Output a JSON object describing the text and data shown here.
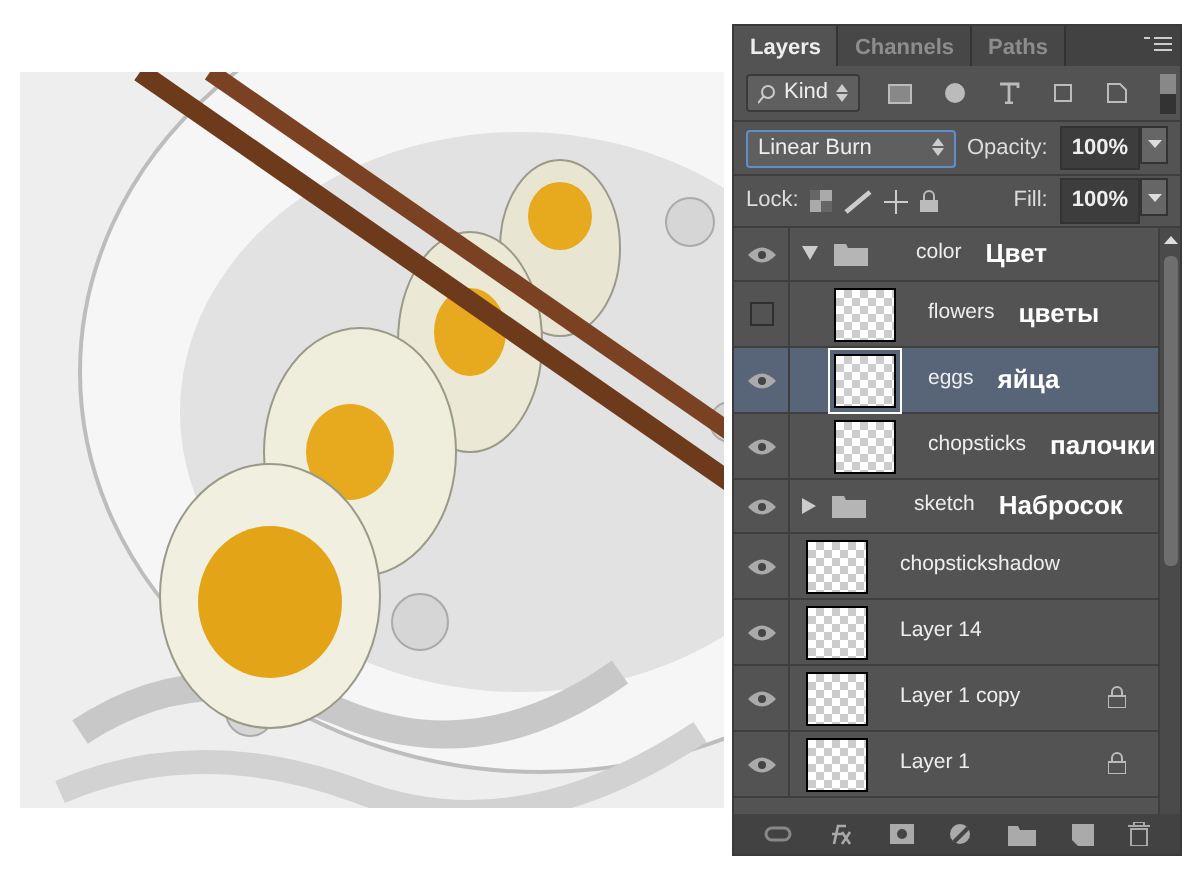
{
  "tabs": [
    {
      "label": "Layers",
      "selected": true
    },
    {
      "label": "Channels",
      "selected": false
    },
    {
      "label": "Paths",
      "selected": false
    }
  ],
  "filter": {
    "label": "Kind"
  },
  "blend_mode": "Linear Burn",
  "opacity_label": "Opacity:",
  "opacity": "100%",
  "lock_label": "Lock:",
  "fill_label": "Fill:",
  "fill": "100%",
  "layers": [
    {
      "kind": "group",
      "name": "color",
      "annotation": "Цвет",
      "visible": true,
      "expanded": true,
      "selected": false,
      "children": [
        {
          "kind": "layer",
          "name": "flowers",
          "annotation": "цветы",
          "visible": false,
          "selected": false,
          "locked": false
        },
        {
          "kind": "layer",
          "name": "eggs",
          "annotation": "яйца",
          "visible": true,
          "selected": true,
          "locked": false
        },
        {
          "kind": "layer",
          "name": "chopsticks",
          "annotation": "палочки",
          "visible": true,
          "selected": false,
          "locked": false
        }
      ]
    },
    {
      "kind": "group",
      "name": "sketch",
      "annotation": "Набросок",
      "visible": true,
      "expanded": false,
      "selected": false
    },
    {
      "kind": "layer",
      "name": "chopstickshadow",
      "visible": true,
      "selected": false,
      "locked": false
    },
    {
      "kind": "layer",
      "name": "Layer 14",
      "visible": true,
      "selected": false,
      "locked": false
    },
    {
      "kind": "layer",
      "name": "Layer 1 copy",
      "visible": true,
      "selected": false,
      "locked": true
    },
    {
      "kind": "layer",
      "name": "Layer 1",
      "visible": true,
      "selected": false,
      "locked": true
    }
  ]
}
